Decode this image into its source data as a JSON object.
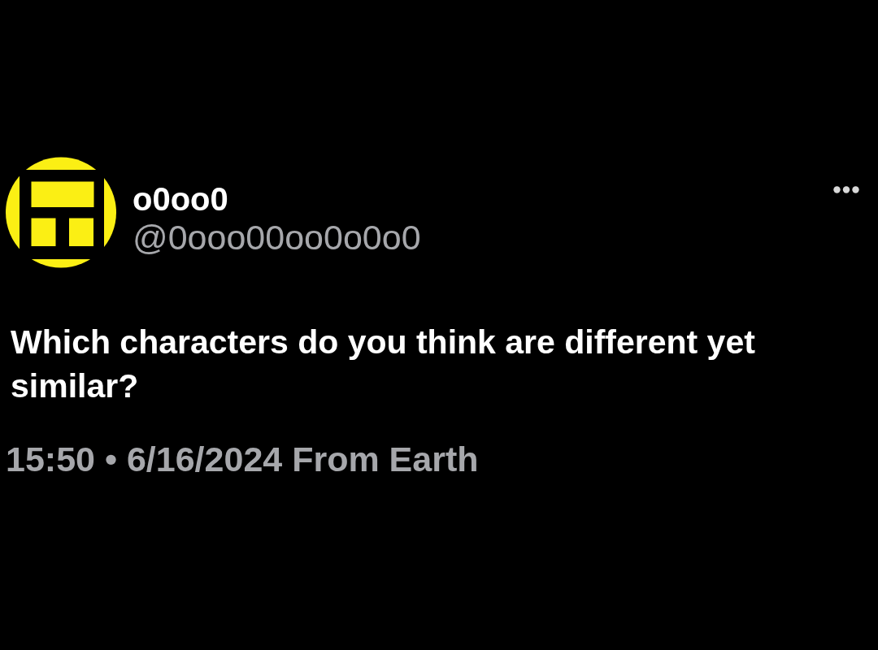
{
  "author": {
    "display_name": "o0oo0",
    "handle": "@0ooo00oo0o0o0"
  },
  "post": {
    "text": "Which characters do you think are different yet similar?",
    "timestamp": "15:50 • 6/16/2024 From Earth"
  }
}
